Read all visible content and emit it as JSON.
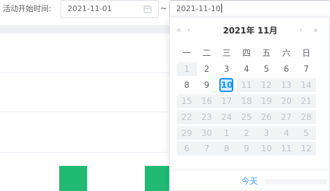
{
  "filter": {
    "label": "活动开始时间:",
    "start_value": "2021-11-01",
    "separator": "~",
    "end_value": "2021-11-10"
  },
  "calendar": {
    "title": "2021年 11月",
    "nav_prev_year": "«",
    "nav_prev_month": "‹",
    "nav_next_month": "›",
    "nav_next_year": "»",
    "weekdays": [
      "一",
      "二",
      "三",
      "四",
      "五",
      "六",
      "日"
    ],
    "weeks": [
      [
        {
          "d": "1",
          "s": "disabled-prev"
        },
        {
          "d": "2",
          "s": "normal"
        },
        {
          "d": "3",
          "s": "normal"
        },
        {
          "d": "4",
          "s": "normal"
        },
        {
          "d": "5",
          "s": "normal"
        },
        {
          "d": "6",
          "s": "normal"
        },
        {
          "d": "7",
          "s": "normal"
        }
      ],
      [
        {
          "d": "8",
          "s": "normal"
        },
        {
          "d": "9",
          "s": "normal"
        },
        {
          "d": "10",
          "s": "today"
        },
        {
          "d": "11",
          "s": "disabled"
        },
        {
          "d": "12",
          "s": "disabled"
        },
        {
          "d": "13",
          "s": "disabled"
        },
        {
          "d": "14",
          "s": "disabled"
        }
      ],
      [
        {
          "d": "15",
          "s": "disabled"
        },
        {
          "d": "16",
          "s": "disabled"
        },
        {
          "d": "17",
          "s": "disabled"
        },
        {
          "d": "18",
          "s": "disabled"
        },
        {
          "d": "19",
          "s": "disabled"
        },
        {
          "d": "20",
          "s": "disabled"
        },
        {
          "d": "21",
          "s": "disabled"
        }
      ],
      [
        {
          "d": "22",
          "s": "disabled"
        },
        {
          "d": "23",
          "s": "disabled"
        },
        {
          "d": "24",
          "s": "disabled"
        },
        {
          "d": "25",
          "s": "disabled"
        },
        {
          "d": "26",
          "s": "disabled"
        },
        {
          "d": "27",
          "s": "disabled"
        },
        {
          "d": "28",
          "s": "disabled"
        }
      ],
      [
        {
          "d": "29",
          "s": "disabled"
        },
        {
          "d": "30",
          "s": "disabled"
        },
        {
          "d": "1",
          "s": "disabled"
        },
        {
          "d": "2",
          "s": "disabled"
        },
        {
          "d": "3",
          "s": "disabled"
        },
        {
          "d": "4",
          "s": "disabled"
        },
        {
          "d": "5",
          "s": "disabled"
        }
      ],
      [
        {
          "d": "6",
          "s": "disabled"
        },
        {
          "d": "7",
          "s": "disabled"
        },
        {
          "d": "8",
          "s": "disabled"
        },
        {
          "d": "9",
          "s": "disabled"
        },
        {
          "d": "10",
          "s": "disabled"
        },
        {
          "d": "11",
          "s": "disabled"
        },
        {
          "d": "12",
          "s": "disabled"
        }
      ]
    ],
    "today_button": "今天"
  },
  "colors": {
    "accent": "#1890ff",
    "link": "#409eff",
    "green_button": "#21ba72",
    "disabled_bg": "#f2f3f5"
  },
  "icons": {
    "date": "calendar-icon"
  }
}
